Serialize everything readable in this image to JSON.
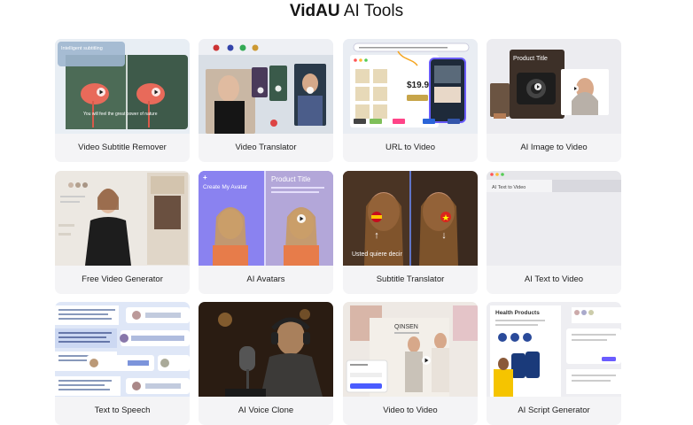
{
  "header": {
    "brand": "VidAU",
    "title_rest": "AI Tools"
  },
  "colors": {
    "background": "#ffffff",
    "card": "#f4f4f6",
    "accent": "#6a5cff"
  },
  "tools": [
    {
      "label": "Video Subtitle Remover",
      "thumb": {
        "badge": "Intelligent subtitling",
        "caption": "You will feel the great power of nature"
      }
    },
    {
      "label": "Video Translator"
    },
    {
      "label": "URL to Video",
      "thumb": {
        "price": "$19.9"
      }
    },
    {
      "label": "AI Image to Video",
      "thumb": {
        "title": "Product Title"
      }
    },
    {
      "label": "Free Video Generator"
    },
    {
      "label": "AI Avatars",
      "thumb": {
        "create": "Create My Avatar",
        "title": "Product Title"
      }
    },
    {
      "label": "Subtitle Translator",
      "thumb": {
        "caption": "Usted quiere decir"
      }
    },
    {
      "label": "AI Text to Video",
      "thumb": {
        "tab": "AI Text to Video"
      }
    },
    {
      "label": "Text to Speech"
    },
    {
      "label": "AI Voice Clone"
    },
    {
      "label": "Video to Video",
      "thumb": {
        "brand": "QINSEN"
      }
    },
    {
      "label": "AI Script Generator",
      "thumb": {
        "title": "Health Products"
      }
    }
  ]
}
